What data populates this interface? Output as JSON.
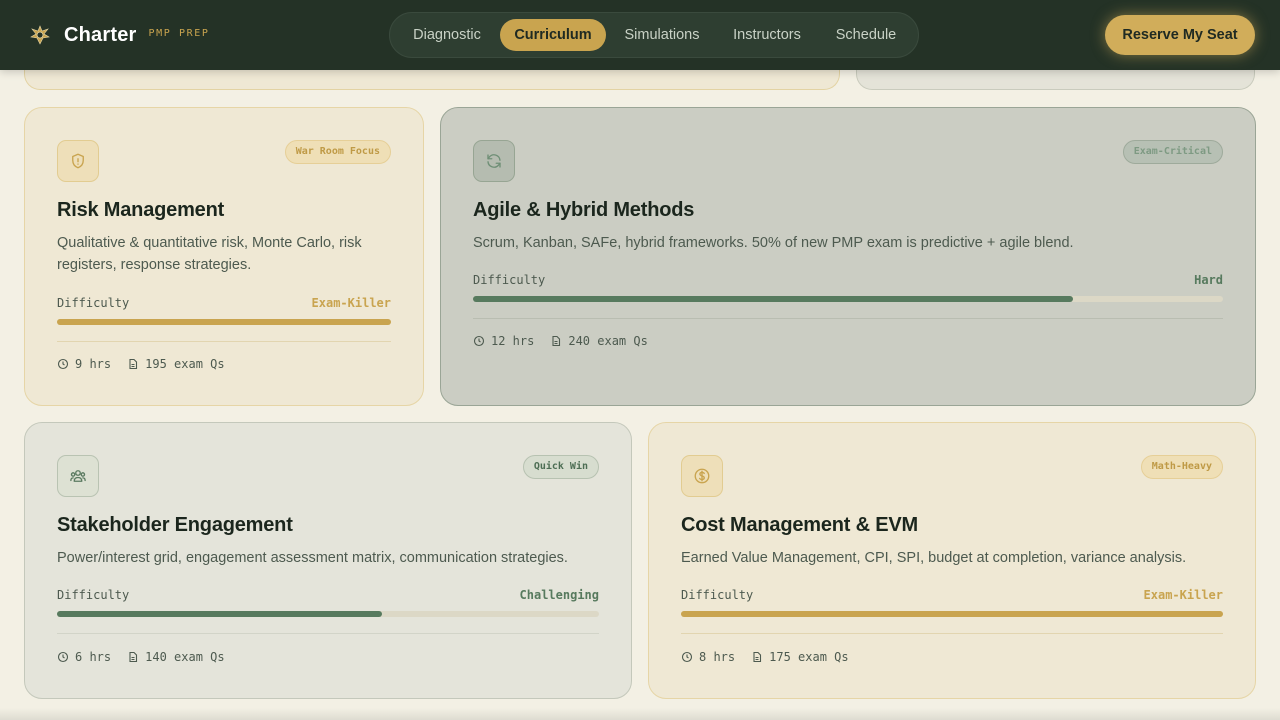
{
  "header": {
    "brand_name": "Charter",
    "brand_tag": "PMP PREP",
    "cta_label": "Reserve My Seat",
    "nav": [
      {
        "label": "Diagnostic",
        "active": false
      },
      {
        "label": "Curriculum",
        "active": true
      },
      {
        "label": "Simulations",
        "active": false
      },
      {
        "label": "Instructors",
        "active": false
      },
      {
        "label": "Schedule",
        "active": false
      }
    ]
  },
  "colors": {
    "header_bg": "#243226",
    "accent_gold": "#c9a44f",
    "accent_sage": "#577a5e",
    "page_bg": "#f3f0e4"
  },
  "cards": [
    {
      "icon": "shield-alert-icon",
      "badge": "War Room Focus",
      "title": "Risk Management",
      "desc": "Qualitative & quantitative risk, Monte Carlo, risk registers, response strategies.",
      "difficulty_label": "Difficulty",
      "difficulty_value": "Exam-Killer",
      "difficulty_fraction": 1.0,
      "hours": "9 hrs",
      "questions": "195 exam Qs"
    },
    {
      "icon": "refresh-icon",
      "badge": "Exam-Critical",
      "title": "Agile & Hybrid Methods",
      "desc": "Scrum, Kanban, SAFe, hybrid frameworks. 50% of new PMP exam is predictive + agile blend.",
      "difficulty_label": "Difficulty",
      "difficulty_value": "Hard",
      "difficulty_fraction": 0.8,
      "hours": "12 hrs",
      "questions": "240 exam Qs"
    },
    {
      "icon": "people-icon",
      "badge": "Quick Win",
      "title": "Stakeholder Engagement",
      "desc": "Power/interest grid, engagement assessment matrix, communication strategies.",
      "difficulty_label": "Difficulty",
      "difficulty_value": "Challenging",
      "difficulty_fraction": 0.6,
      "hours": "6 hrs",
      "questions": "140 exam Qs"
    },
    {
      "icon": "dollar-coin-icon",
      "badge": "Math-Heavy",
      "title": "Cost Management & EVM",
      "desc": "Earned Value Management, CPI, SPI, budget at completion, variance analysis.",
      "difficulty_label": "Difficulty",
      "difficulty_value": "Exam-Killer",
      "difficulty_fraction": 1.0,
      "hours": "8 hrs",
      "questions": "175 exam Qs"
    }
  ]
}
